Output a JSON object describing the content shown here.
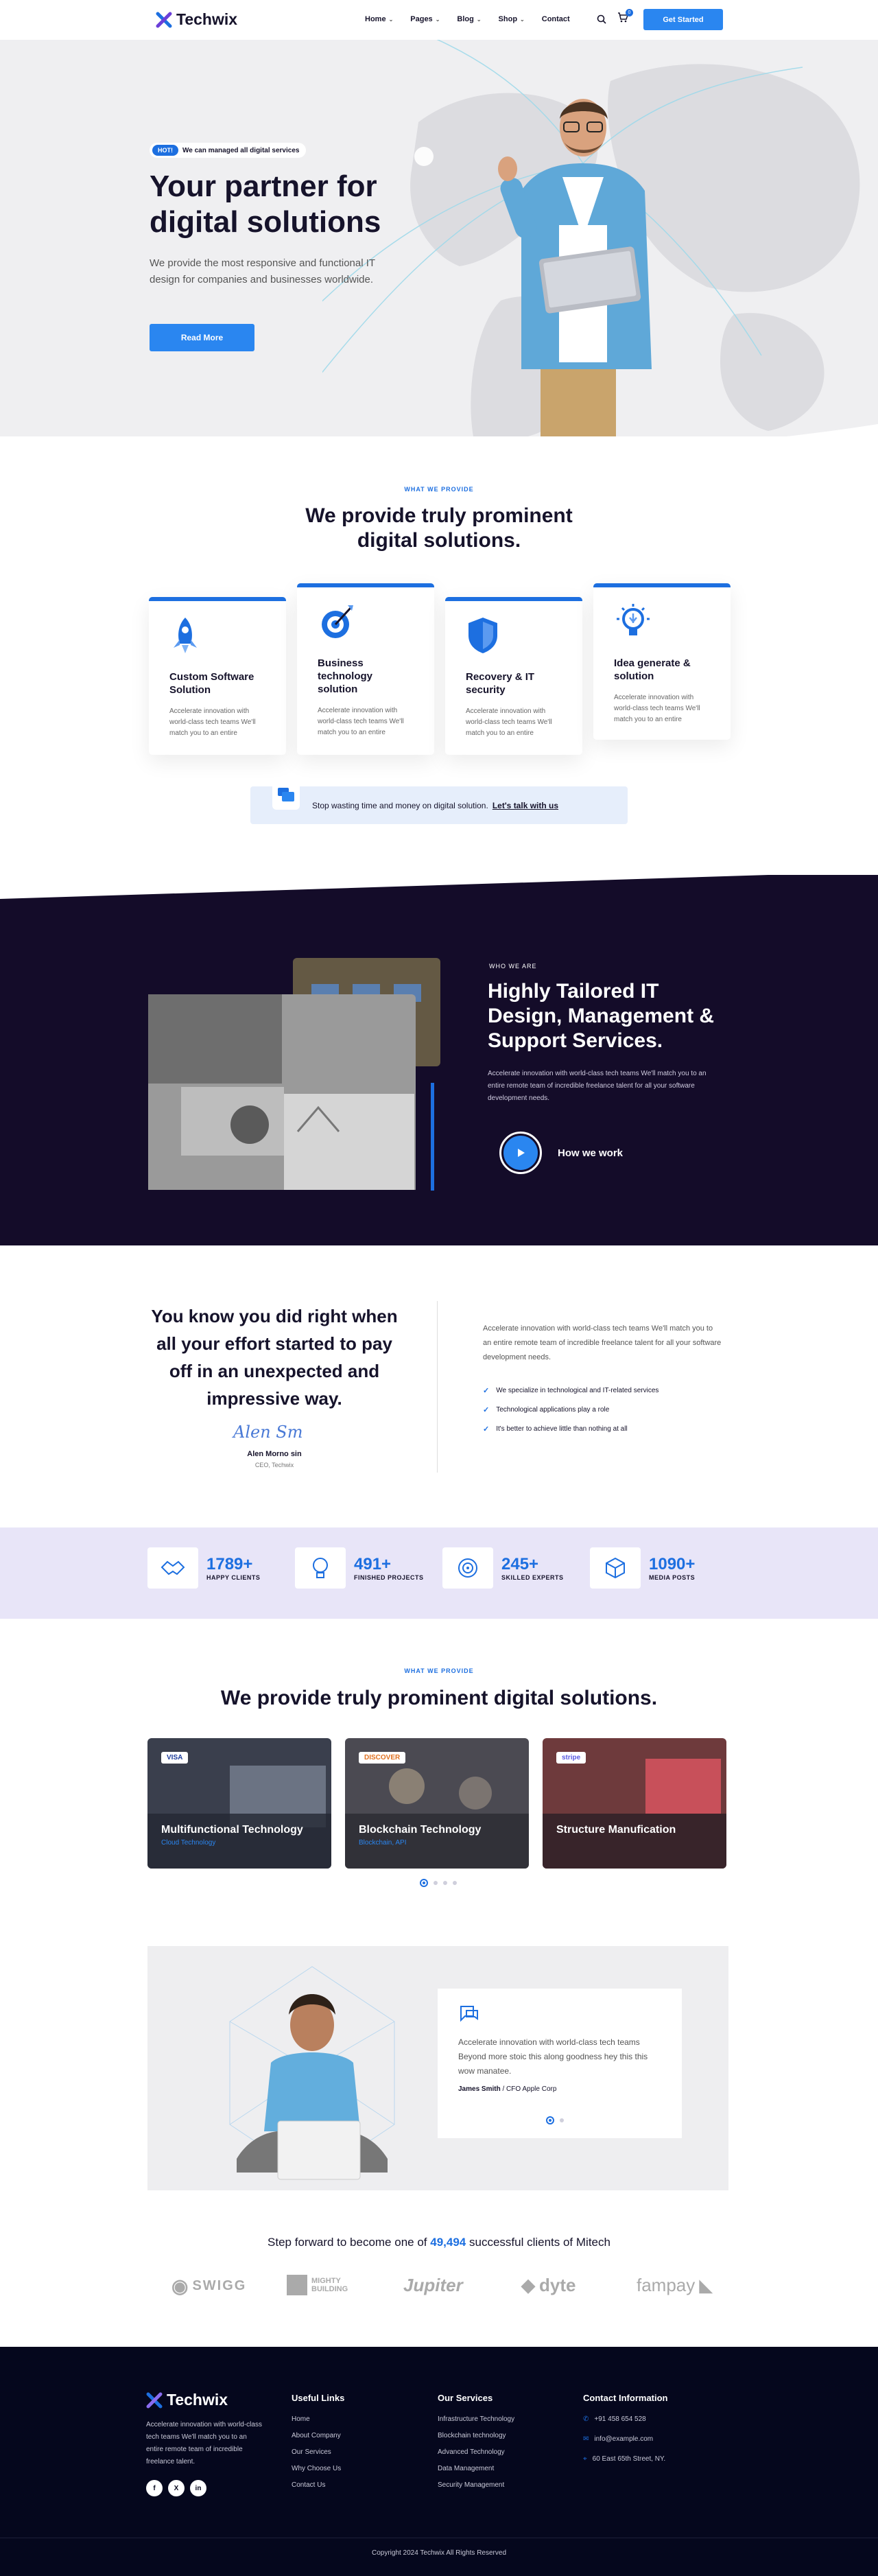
{
  "brand": {
    "name": "Techwix"
  },
  "nav": {
    "items": [
      "Home",
      "Pages",
      "Blog",
      "Shop",
      "Contact"
    ],
    "cart_count": "0",
    "cta": "Get Started"
  },
  "hero": {
    "hot": "HOT!",
    "badge": "We can managed all digital services",
    "title": "Your partner for digital solutions",
    "text": "We provide the most responsive and functional IT design for companies and businesses worldwide.",
    "button": "Read More"
  },
  "services": {
    "kicker": "WHAT WE PROVIDE",
    "title": "We provide truly prominent digital solutions.",
    "cards": [
      {
        "title": "Custom Software Solution",
        "text": "Accelerate innovation with world-class tech teams We'll match you to an entire",
        "icon": "rocket-icon"
      },
      {
        "title": "Business technology solution",
        "text": "Accelerate innovation with world-class tech teams We'll match you to an entire",
        "icon": "target-icon"
      },
      {
        "title": "Recovery & IT security",
        "text": "Accelerate innovation with world-class tech teams We'll match you to an entire",
        "icon": "shield-icon"
      },
      {
        "title": "Idea generate & solution",
        "text": "Accelerate innovation with world-class tech teams We'll match you to an entire",
        "icon": "lightbulb-icon"
      }
    ],
    "cta_text": "Stop wasting time and money on digital solution.",
    "cta_link": "Let's talk with us"
  },
  "about": {
    "kicker": "WHO WE ARE",
    "title": "Highly Tailored IT Design, Management & Support Services.",
    "text": "Accelerate innovation with world-class tech teams We'll match you to an entire remote team of incredible freelance talent for all your software development needs.",
    "video_label": "How we work"
  },
  "quote": {
    "headline": "You know you did right when all your effort started to pay off in an unexpected and impressive way.",
    "signature": "Alen Sm",
    "name": "Alen Morno sin",
    "role": "CEO, Techwix",
    "text": "Accelerate innovation with world-class tech teams We'll match you to an entire remote team of incredible freelance talent for all your software development needs.",
    "checks": [
      "We specialize in technological and IT-related services",
      "Technological applications play a role",
      "It's better to achieve little than nothing at all"
    ]
  },
  "stats": [
    {
      "num": "1789+",
      "label": "HAPPY CLIENTS",
      "icon": "handshake-icon"
    },
    {
      "num": "491+",
      "label": "FINISHED PROJECTS",
      "icon": "lightbulb-icon"
    },
    {
      "num": "245+",
      "label": "SKILLED EXPERTS",
      "icon": "target-icon"
    },
    {
      "num": "1090+",
      "label": "MEDIA POSTS",
      "icon": "cube-icon"
    }
  ],
  "portfolio": {
    "kicker": "WHAT WE PROVIDE",
    "title": "We provide truly prominent digital solutions.",
    "items": [
      {
        "tag": "VISA",
        "title": "Multifunctional Technology",
        "sub": "Cloud Technology"
      },
      {
        "tag": "DISCOVER",
        "title": "Blockchain Technology",
        "sub": "Blockchain, API"
      },
      {
        "tag": "stripe",
        "title": "Structure Manufication",
        "sub": ""
      }
    ]
  },
  "testimonial": {
    "text": "Accelerate innovation with world-class tech teams Beyond more stoic this along goodness hey this this wow manatee.",
    "name": "James Smith",
    "role": "/ CFO Apple Corp"
  },
  "clients": {
    "pre": "Step forward to become one of",
    "count": "49,494",
    "post": "successful clients of Mitech",
    "logos": [
      "SWIGG",
      "MIGHTY BUILDING",
      "Jupiter",
      "dyte",
      "fampay"
    ]
  },
  "footer": {
    "about": "Accelerate innovation with world-class tech teams We'll match you to an entire remote team of incredible freelance talent.",
    "social": [
      "f",
      "X",
      "in"
    ],
    "col1": {
      "title": "Useful Links",
      "items": [
        "Home",
        "About Company",
        "Our Services",
        "Why Choose Us",
        "Contact Us"
      ]
    },
    "col2": {
      "title": "Our Services",
      "items": [
        "Infrastructure Technology",
        "Blockchain technology",
        "Advanced Technology",
        "Data Management",
        "Security Management"
      ]
    },
    "col3": {
      "title": "Contact Information",
      "items": [
        "+91 458 654 528",
        "info@example.com",
        "60 East 65th Street, NY."
      ]
    },
    "copyright": "Copyright 2024 Techwix All Rights Reserved"
  },
  "colors": {
    "accent": "#1d6fe0",
    "dark": "#140c29",
    "footer": "#05071d"
  }
}
